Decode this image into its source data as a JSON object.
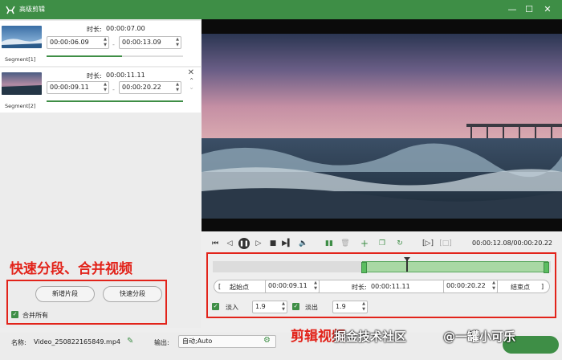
{
  "window": {
    "title": "高级剪辑",
    "minimize": "—",
    "maximize": "☐",
    "close": "✕"
  },
  "segments": [
    {
      "label": "Segment[1]",
      "duration_label": "时长:",
      "duration": "00:00:07.00",
      "start": "00:00:06.09",
      "end": "00:00:13.09",
      "progress": 0.55
    },
    {
      "label": "Segment[2]",
      "duration_label": "时长:",
      "duration": "00:00:11.11",
      "start": "00:00:09.11",
      "end": "00:00:20.22",
      "progress": 1.0
    }
  ],
  "segment_dash": "-",
  "annotations": {
    "left": "快速分段、合并视频",
    "right": "剪辑视频"
  },
  "split_panel": {
    "add_segment": "新增片段",
    "quick_split": "快速分段",
    "merge_all": "合并所有"
  },
  "player": {
    "timecode": "00:00:12.08/00:00:20.22",
    "playhead_fraction": 0.6
  },
  "trim": {
    "start_label": "起始点",
    "start": "00:00:09.11",
    "duration_label": "时长:",
    "duration": "00:00:11.11",
    "end": "00:00:20.22",
    "end_label": "结束点",
    "bracket_left": "[",
    "bracket_right": "]",
    "fade_in_label": "淡入",
    "fade_in": "1.9",
    "fade_out_label": "淡出",
    "fade_out": "1.9"
  },
  "output": {
    "name_label": "名称:",
    "name_value": "Video_250822165849.mp4",
    "output_label": "输出:",
    "output_value": "自动;Auto"
  },
  "watermark": {
    "community": "掘金技术社区",
    "author": "@一罐小可乐"
  },
  "colors": {
    "accent": "#3e8e46",
    "annotation": "#e2231a"
  },
  "icons": [
    "app-logo-icon",
    "edit-pencil-icon",
    "gear-icon",
    "prev-frame-icon",
    "step-back-icon",
    "pause-icon",
    "step-forward-icon",
    "stop-icon",
    "mark-out-icon",
    "volume-icon",
    "split-icon",
    "delete-icon",
    "add-icon",
    "copy-icon",
    "rotate-icon",
    "bracket-in-icon",
    "bracket-out-icon"
  ]
}
